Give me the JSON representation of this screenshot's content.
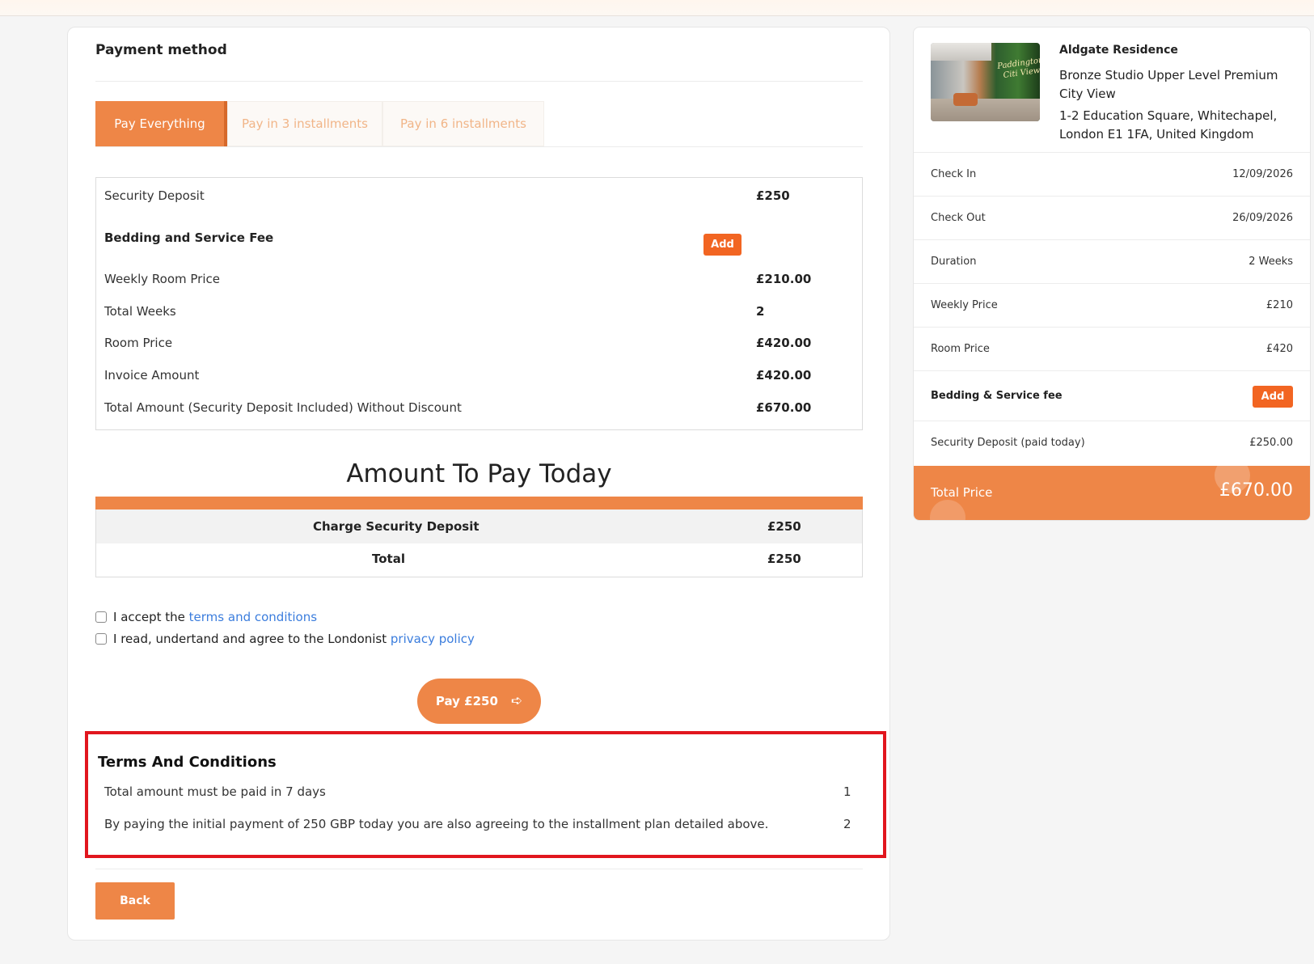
{
  "payment": {
    "title": "Payment method",
    "tabs": [
      {
        "label": "Pay Everything",
        "active": true
      },
      {
        "label": "Pay in 3 installments",
        "active": false
      },
      {
        "label": "Pay in 6 installments",
        "active": false
      }
    ],
    "fees": {
      "security_deposit": {
        "label": "Security Deposit",
        "value": "£250"
      },
      "bedding": {
        "label": "Bedding and Service Fee",
        "button": "Add"
      },
      "weekly_room_price": {
        "label": "Weekly Room Price",
        "value": "£210.00"
      },
      "total_weeks": {
        "label": "Total Weeks",
        "value": "2"
      },
      "room_price": {
        "label": "Room Price",
        "value": "£420.00"
      },
      "invoice_amount": {
        "label": "Invoice Amount",
        "value": "£420.00"
      },
      "total_amount": {
        "label": "Total Amount (Security Deposit Included) Without Discount",
        "value": "£670.00"
      }
    },
    "amount_title": "Amount To Pay Today",
    "pay_today": {
      "rows": [
        {
          "label": "Charge Security Deposit",
          "value": "£250"
        },
        {
          "label": "Total",
          "value": "£250"
        }
      ]
    },
    "checks": {
      "terms_prefix": "I accept the ",
      "terms_link": "terms and conditions",
      "privacy_prefix": "I read, undertand and agree to the Londonist ",
      "privacy_link": "privacy policy"
    },
    "pay_button": "Pay £250",
    "terms": {
      "title": "Terms And Conditions",
      "items": [
        {
          "text": "Total amount must be paid in 7 days",
          "num": "1"
        },
        {
          "text": "By paying the initial payment of 250 GBP today you are also agreeing to the installment plan detailed above.",
          "num": "2"
        }
      ]
    },
    "back_button": "Back"
  },
  "summary": {
    "hotel": "Aldgate Residence",
    "room": "Bronze Studio Upper Level Premium City View",
    "address": "1-2 Education Square, Whitechapel, London E1 1FA, United Kingdom",
    "thumb_sign": "Paddington\nCiti View",
    "rows": {
      "check_in": {
        "label": "Check In",
        "value": "12/09/2026"
      },
      "check_out": {
        "label": "Check Out",
        "value": "26/09/2026"
      },
      "duration": {
        "label": "Duration",
        "value": "2 Weeks"
      },
      "weekly_price": {
        "label": "Weekly Price",
        "value": "£210"
      },
      "room_price": {
        "label": "Room Price",
        "value": "£420"
      },
      "bedding": {
        "label": "Bedding & Service fee",
        "button": "Add"
      },
      "security_deposit": {
        "label": "Security Deposit (paid today)",
        "value": "£250.00"
      }
    },
    "total": {
      "label": "Total Price",
      "value": "£670.00"
    }
  },
  "colors": {
    "accent": "#ee8647",
    "add_button": "#f26522",
    "link": "#3b7ddd",
    "highlight_border": "#e1161e"
  }
}
